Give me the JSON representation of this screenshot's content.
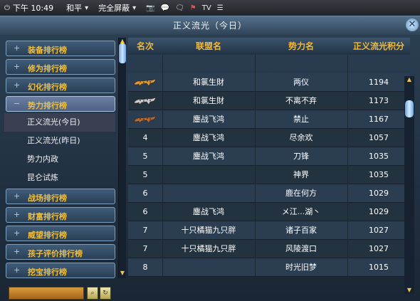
{
  "statusbar": {
    "time": "下午 10:49",
    "mode": "和平",
    "display": "完全屏蔽",
    "tv": "TV"
  },
  "window": {
    "title": "正义流光（今日）"
  },
  "sidebar": {
    "categories_top": [
      {
        "label": "装备排行榜"
      },
      {
        "label": "修为排行榜"
      },
      {
        "label": "幻化排行榜"
      }
    ],
    "active_category": {
      "label": "势力排行榜"
    },
    "sub_items": [
      {
        "label": "正义流光(今日)",
        "selected": true
      },
      {
        "label": "正义流光(昨日)",
        "selected": false
      },
      {
        "label": "势力内政",
        "selected": false
      },
      {
        "label": "昆仑试炼",
        "selected": false
      }
    ],
    "categories_bottom": [
      {
        "label": "战场排行榜"
      },
      {
        "label": "财富排行榜"
      },
      {
        "label": "威望排行榜"
      },
      {
        "label": "孩子评价排行榜"
      },
      {
        "label": "挖宝排行榜"
      }
    ]
  },
  "table": {
    "headers": [
      "名次",
      "联盟名",
      "势力名",
      "正义流光积分"
    ],
    "rows": [
      {
        "rank": "",
        "rank_icon": "gold-leopard-icon",
        "alliance": "和氯生財",
        "faction": "两仪",
        "score": "1194"
      },
      {
        "rank": "",
        "rank_icon": "silver-leopard-icon",
        "alliance": "和氯生財",
        "faction": "不离不弃",
        "score": "1173"
      },
      {
        "rank": "",
        "rank_icon": "bronze-leopard-icon",
        "alliance": "鏖战飞鸿",
        "faction": "禁止",
        "score": "1167"
      },
      {
        "rank": "4",
        "rank_icon": "",
        "alliance": "鏖战飞鸿",
        "faction": "尽余欢",
        "score": "1057"
      },
      {
        "rank": "5",
        "rank_icon": "",
        "alliance": "鏖战飞鸿",
        "faction": "刀锋",
        "score": "1035"
      },
      {
        "rank": "5",
        "rank_icon": "",
        "alliance": "",
        "faction": "神界",
        "score": "1035"
      },
      {
        "rank": "6",
        "rank_icon": "",
        "alliance": "",
        "faction": "鹿在何方",
        "score": "1029"
      },
      {
        "rank": "6",
        "rank_icon": "",
        "alliance": "鏖战飞鸿",
        "faction": "メ江...湖丶",
        "score": "1029"
      },
      {
        "rank": "7",
        "rank_icon": "",
        "alliance": "十只橘猫九只胖",
        "faction": "诸子百家",
        "score": "1027"
      },
      {
        "rank": "7",
        "rank_icon": "",
        "alliance": "十只橘猫九只胖",
        "faction": "风陵渡口",
        "score": "1027"
      },
      {
        "rank": "8",
        "rank_icon": "",
        "alliance": "",
        "faction": "时光旧梦",
        "score": "1015"
      }
    ]
  },
  "colors": {
    "header_text": "#f0b93a",
    "category_text": "#f1bf3c",
    "panel_bg": "#22323f"
  }
}
